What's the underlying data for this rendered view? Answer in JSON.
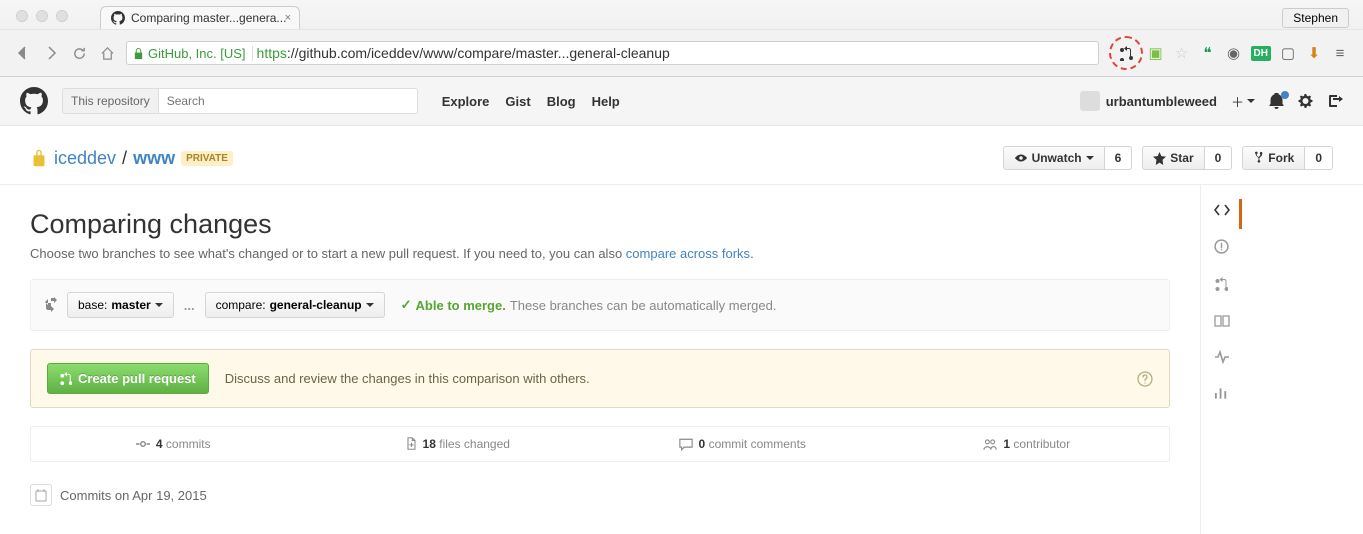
{
  "browser": {
    "profile": "Stephen",
    "tab_title": "Comparing master...genera...",
    "ssl_org": "GitHub, Inc. [US]",
    "url_proto": "https",
    "url_rest": "://github.com/iceddev/www/compare/master...general-cleanup"
  },
  "header": {
    "search_scope": "This repository",
    "search_placeholder": "Search",
    "nav": {
      "explore": "Explore",
      "gist": "Gist",
      "blog": "Blog",
      "help": "Help"
    },
    "username": "urbantumbleweed"
  },
  "repo": {
    "owner": "iceddev",
    "name": "www",
    "private_label": "private",
    "unwatch": "Unwatch",
    "watch_count": "6",
    "star": "Star",
    "star_count": "0",
    "fork": "Fork",
    "fork_count": "0"
  },
  "compare": {
    "title": "Comparing changes",
    "subtitle_a": "Choose two branches to see what's changed or to start a new pull request. If you need to, you can also ",
    "subtitle_link": "compare across forks",
    "subtitle_b": ".",
    "base_label": "base:",
    "base_value": "master",
    "compare_label": "compare:",
    "compare_value": "general-cleanup",
    "dots": "...",
    "merge_check": "✓",
    "merge_ok": "Able to merge.",
    "merge_desc": "These branches can be automatically merged.",
    "create_pr": "Create pull request",
    "pr_desc": "Discuss and review the changes in this comparison with others."
  },
  "stats": {
    "commits_n": "4",
    "commits_l": "commits",
    "files_n": "18",
    "files_l": "files changed",
    "comments_n": "0",
    "comments_l": "commit comments",
    "contrib_n": "1",
    "contrib_l": "contributor"
  },
  "timeline": {
    "date_label": "Commits on Apr 19, 2015"
  }
}
